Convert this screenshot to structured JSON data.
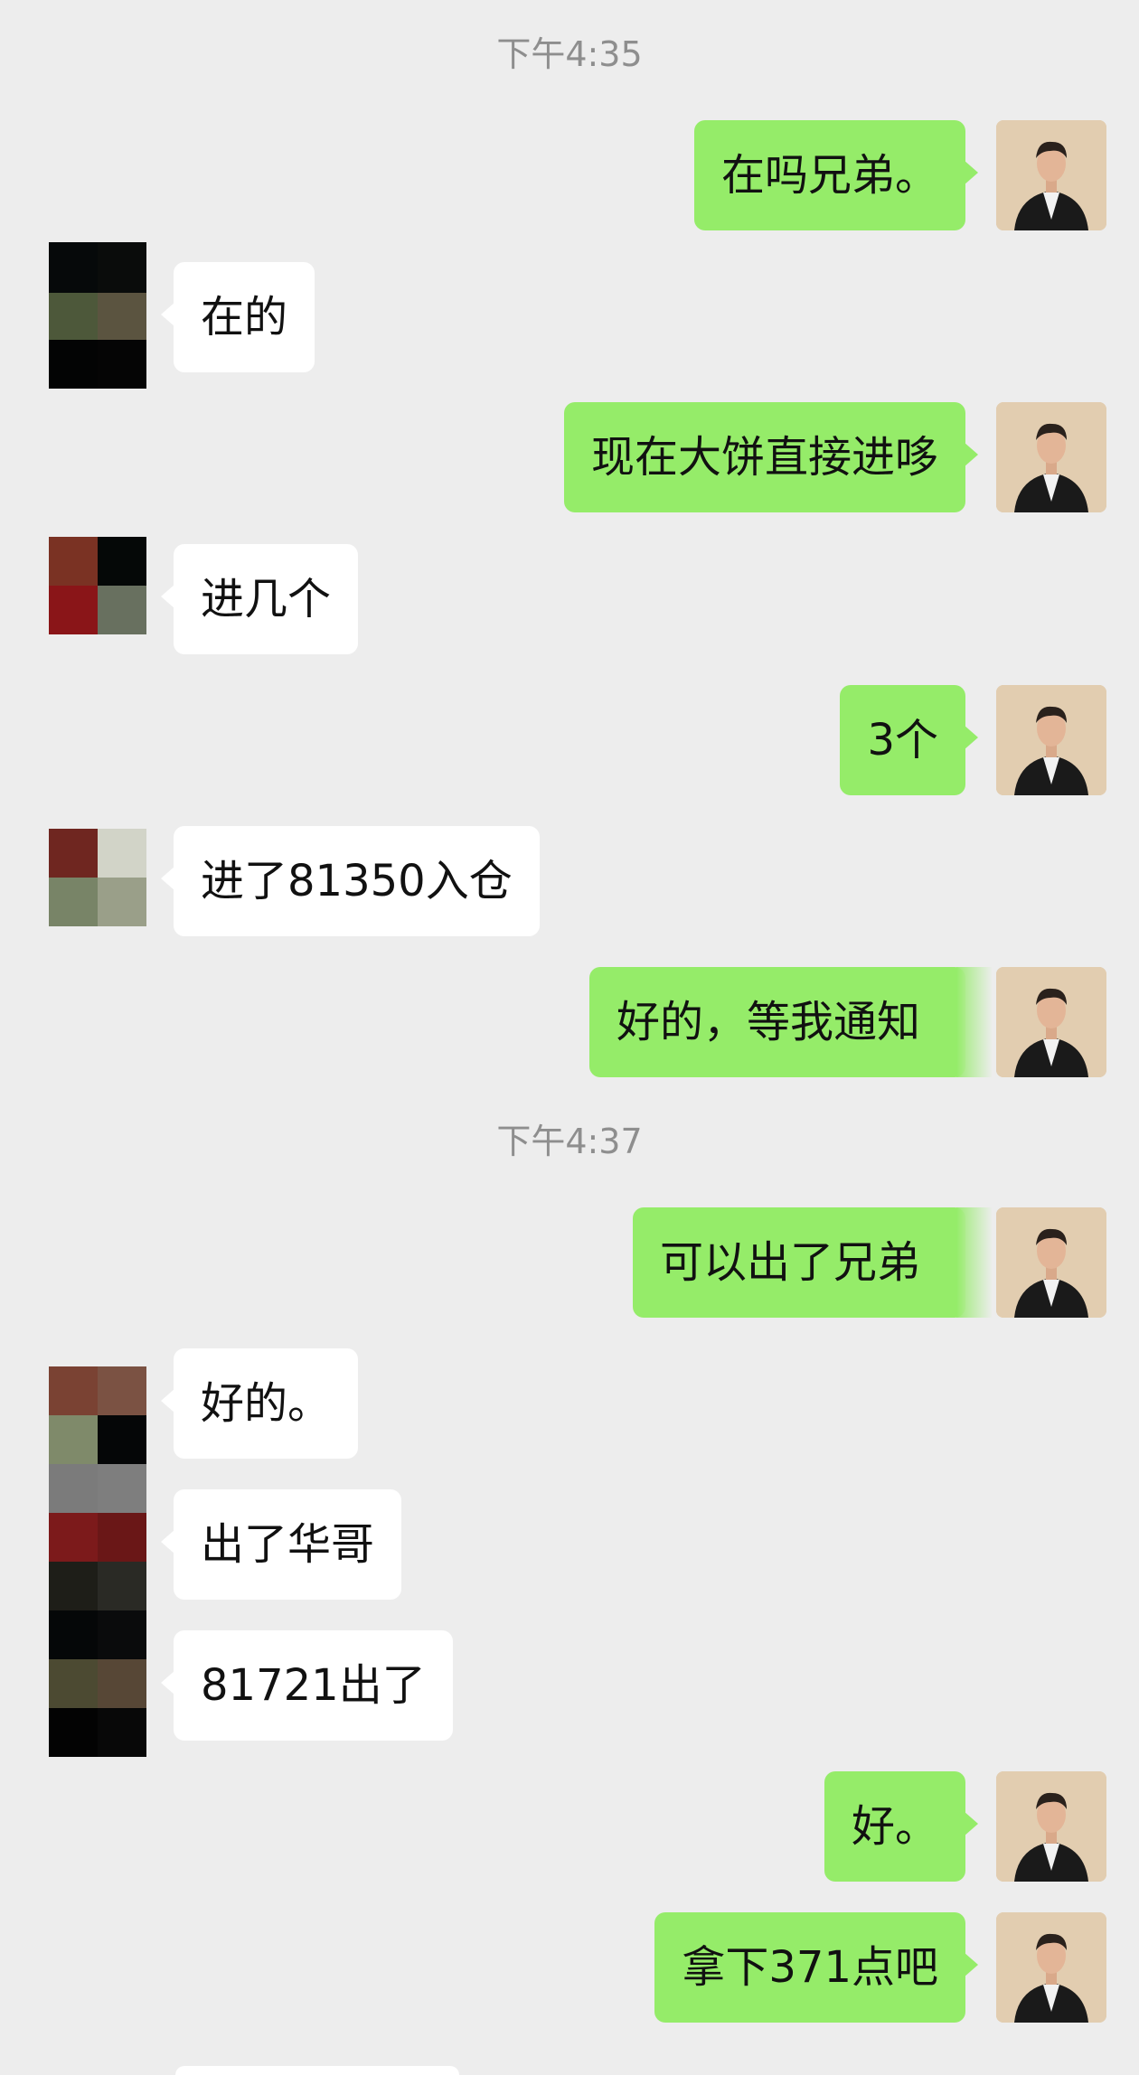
{
  "timestamps": [
    "下午4:35",
    "下午4:37"
  ],
  "messages": [
    {
      "from": "me",
      "text": "在吗兄弟。"
    },
    {
      "from": "them",
      "text": "在的"
    },
    {
      "from": "me",
      "text": "现在大饼直接进哆"
    },
    {
      "from": "them",
      "text": "进几个"
    },
    {
      "from": "me",
      "text": "3个"
    },
    {
      "from": "them",
      "text": "进了81350入仓"
    },
    {
      "from": "me",
      "text": "好的，等我通知"
    },
    {
      "from": "me",
      "text": "可以出了兄弟"
    },
    {
      "from": "them",
      "text": "好的。"
    },
    {
      "from": "them",
      "text": "出了华哥"
    },
    {
      "from": "them",
      "text": "81721出了"
    },
    {
      "from": "me",
      "text": "好。"
    },
    {
      "from": "me",
      "text": "拿下371点吧"
    }
  ],
  "colors": {
    "background": "#EDEDED",
    "my_bubble": "#95EC69",
    "their_bubble": "#FFFFFF",
    "timestamp_text": "#8E8E8E"
  },
  "icons": {
    "my_avatar": "man-in-black-suit-avatar",
    "their_avatar": "pixelated-mosaic-avatar"
  }
}
